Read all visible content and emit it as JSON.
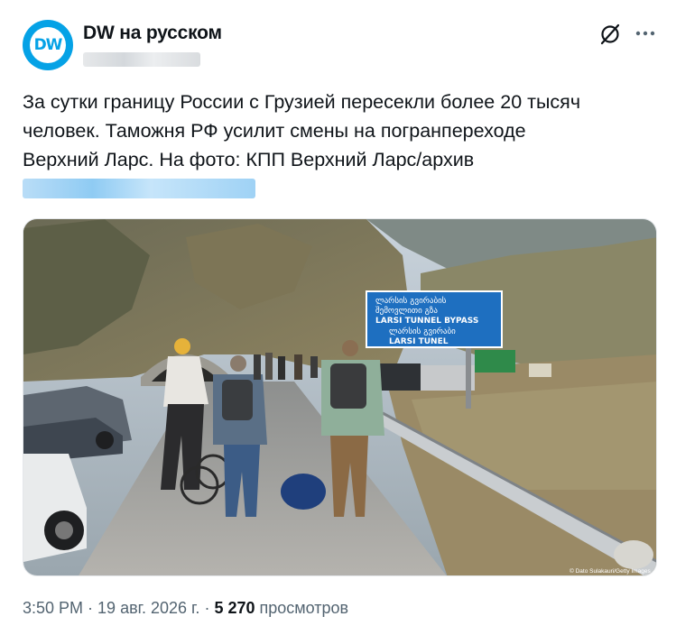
{
  "author": {
    "name": "DW на русском",
    "avatar_text": "DW",
    "verified_color": "#05a2e6"
  },
  "post": {
    "text_lines": [
      "За сутки границу России с Грузией пересекли более 20 тысяч",
      "человек. Таможня РФ усилит смены на погранпереходе",
      "Верхний Ларс. На фото: КПП Верхний Ларс/архив"
    ]
  },
  "photo": {
    "sign_line1": "ლარსის გვირაბის",
    "sign_line2": "შემოვლითი გზა",
    "sign_line3": "LARSI TUNNEL BYPASS",
    "sign_line4": "ლარსის გვირაბი",
    "sign_line5": "LARSI TUNEL",
    "credit": "© Dato Sulakauri/Getty Images"
  },
  "meta": {
    "time": "3:50 PM",
    "date": "19 авг. 2026 г.",
    "views_count": "5 270",
    "views_label": "просмотров"
  },
  "icons": {
    "grok": "grok-icon",
    "more": "more-icon"
  },
  "colors": {
    "text": "#0f1419",
    "secondary": "#536471",
    "brand": "#05a2e6",
    "sign_blue": "#1e6fc0"
  }
}
